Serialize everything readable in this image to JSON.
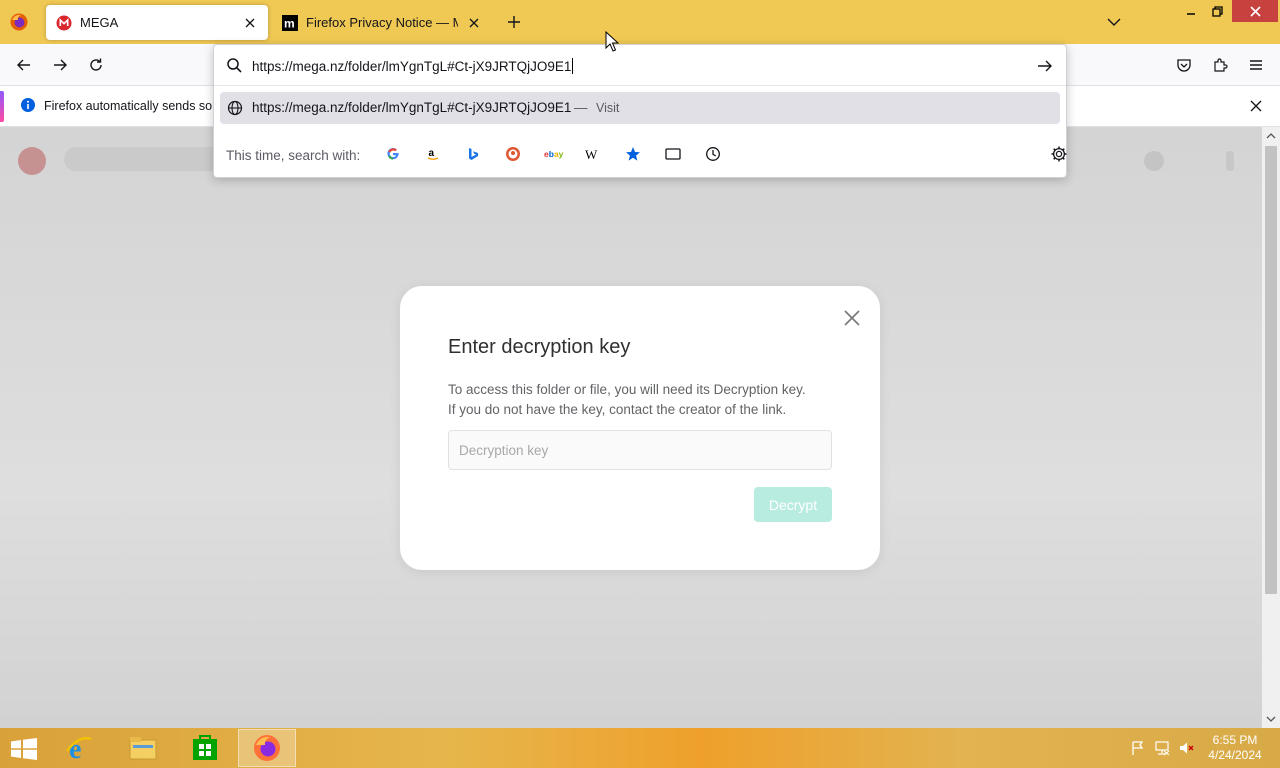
{
  "browser": {
    "tabs": [
      {
        "title": "MEGA",
        "active": true
      },
      {
        "title": "Firefox Privacy Notice — Mozilla",
        "active": false
      }
    ]
  },
  "notification": {
    "message": "Firefox automatically sends som"
  },
  "urlbar": {
    "value": "https://mega.nz/folder/lmYgnTgL#Ct-jX9JRTQjJO9E1",
    "suggestion": {
      "url": "https://mega.nz/folder/lmYgnTgL#Ct-jX9JRTQjJO9E1",
      "separator": "—",
      "action": "Visit"
    },
    "search_with_label": "This time, search with:",
    "engines": [
      "google-icon",
      "amazon-icon",
      "bing-icon",
      "duckduckgo-icon",
      "ebay-icon",
      "wikipedia-icon",
      "bookmarks-icon",
      "tabs-icon",
      "history-icon"
    ]
  },
  "dialog": {
    "title": "Enter decryption key",
    "desc_line1": "To access this folder or file, you will need its Decryption key.",
    "desc_line2": "If you do not have the key, contact the creator of the link.",
    "input_placeholder": "Decryption key",
    "input_value": "",
    "decrypt_label": "Decrypt"
  },
  "taskbar": {
    "apps": [
      "internet-explorer-icon",
      "file-explorer-icon",
      "store-icon",
      "firefox-icon"
    ],
    "time": "6:55 PM",
    "date": "4/24/2024"
  },
  "colors": {
    "accent_tabstrip": "#f0c954",
    "close_button": "#c7423f",
    "mega_red": "#d9272e",
    "decrypt_disabled": "#b9ece0"
  }
}
